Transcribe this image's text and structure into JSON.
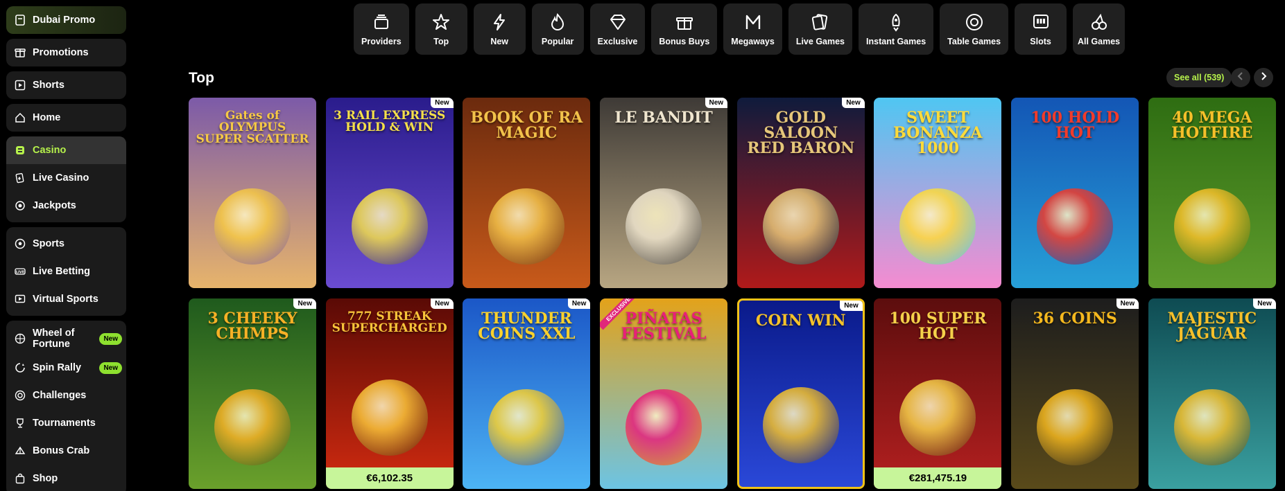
{
  "sidebar": {
    "promo": "Dubai Promo",
    "single": [
      {
        "label": "Promotions",
        "icon": "gift-box-icon"
      },
      {
        "label": "Shorts",
        "icon": "play-square-icon"
      },
      {
        "label": "Home",
        "icon": "home-icon"
      }
    ],
    "casino_group": [
      {
        "label": "Casino",
        "icon": "casino-icon",
        "active": true
      },
      {
        "label": "Live Casino",
        "icon": "live-casino-icon"
      },
      {
        "label": "Jackpots",
        "icon": "jackpot-icon"
      }
    ],
    "sports_group": [
      {
        "label": "Sports",
        "icon": "football-icon"
      },
      {
        "label": "Live Betting",
        "icon": "live-icon"
      },
      {
        "label": "Virtual Sports",
        "icon": "virtual-icon"
      }
    ],
    "extras_group": [
      {
        "label": "Wheel of Fortune",
        "icon": "wheel-icon",
        "badge": "New"
      },
      {
        "label": "Spin Rally",
        "icon": "spin-icon",
        "badge": "New"
      },
      {
        "label": "Challenges",
        "icon": "target-icon"
      },
      {
        "label": "Tournaments",
        "icon": "trophy-icon"
      },
      {
        "label": "Bonus Crab",
        "icon": "crab-icon"
      },
      {
        "label": "Shop",
        "icon": "bag-icon"
      }
    ]
  },
  "categories": [
    {
      "label": "Providers",
      "icon": "stack-icon"
    },
    {
      "label": "Top",
      "icon": "star-icon"
    },
    {
      "label": "New",
      "icon": "lightning-icon"
    },
    {
      "label": "Popular",
      "icon": "flame-icon"
    },
    {
      "label": "Exclusive",
      "icon": "diamond-icon"
    },
    {
      "label": "Bonus Buys",
      "icon": "gift-icon"
    },
    {
      "label": "Megaways",
      "icon": "megaways-icon"
    },
    {
      "label": "Live Games",
      "icon": "cards-icon"
    },
    {
      "label": "Instant Games",
      "icon": "rocket-icon"
    },
    {
      "label": "Table Games",
      "icon": "chip-icon"
    },
    {
      "label": "Slots",
      "icon": "slot-icon"
    },
    {
      "label": "All Games",
      "icon": "cherries-icon"
    }
  ],
  "section": {
    "title": "Top",
    "see_all": "See all (539)"
  },
  "games": [
    {
      "title": "Gates of Olympus Super Scatter",
      "art": "Gates of OLYMPUS SUPER SCATTER",
      "new": false,
      "bg": "#7c5aa8",
      "bg2": "#e7b46b",
      "fg": "#f6c945"
    },
    {
      "title": "3 Rail Express Hold & Win",
      "art": "3 RAIL EXPRESS HOLD & WIN",
      "new": true,
      "bg": "#2a1c8c",
      "bg2": "#6b4cd1",
      "fg": "#f5e04a"
    },
    {
      "title": "Book of Ra Magic",
      "art": "BOOK OF RA MAGIC",
      "new": false,
      "bg": "#6b2a0e",
      "bg2": "#c85a1a",
      "fg": "#f2c24a"
    },
    {
      "title": "Le Bandit",
      "art": "LE BANDIT",
      "new": true,
      "bg": "#3e3a36",
      "bg2": "#b8a682",
      "fg": "#f0e6cf"
    },
    {
      "title": "Gold Saloon Red Baron",
      "art": "GOLD SALOON RED BARON",
      "new": true,
      "bg": "#0f1b3c",
      "bg2": "#b01a1a",
      "fg": "#e6c77a"
    },
    {
      "title": "Sweet Bonanza 1000",
      "art": "SWEET BONANZA 1000",
      "new": false,
      "bg": "#4fc6f2",
      "bg2": "#f58bd0",
      "fg": "#ffdb3a"
    },
    {
      "title": "100 Hold Hot",
      "art": "100 HOLD HOT",
      "new": false,
      "bg": "#1356b5",
      "bg2": "#27a0d8",
      "fg": "#f23b2b"
    },
    {
      "title": "40 Mega Hotfire",
      "art": "40 MEGA HOTFIRE",
      "new": false,
      "bg": "#2e6d12",
      "bg2": "#5e9b2c",
      "fg": "#f6c02a"
    },
    {
      "title": "3 Cheeky Chimps",
      "art": "3 CHEEKY CHIMPS",
      "new": true,
      "bg": "#1f5a1d",
      "bg2": "#6aa02b",
      "fg": "#f6b126"
    },
    {
      "title": "777 Streak Supercharged",
      "art": "777 STREAK SUPERCHARGED",
      "new": true,
      "bg": "#5a0a05",
      "bg2": "#d22b10",
      "fg": "#f8c43a",
      "jackpot": "€6,102.35"
    },
    {
      "title": "Thunder Coins XXL",
      "art": "THUNDER COINS XXL",
      "new": true,
      "bg": "#1b57c7",
      "bg2": "#4db4f5",
      "fg": "#f9d12e"
    },
    {
      "title": "Piñatas Festival",
      "art": "PIÑATAS FESTIVAL",
      "new": false,
      "exclusive": "EXCLUSIVE",
      "bg": "#e3a21a",
      "bg2": "#6cc4e4",
      "fg": "#e81f7a"
    },
    {
      "title": "Coin Win",
      "art": "COIN WIN",
      "new": true,
      "bg": "#0a1a8a",
      "bg2": "#2a48d8",
      "fg": "#f5c22a",
      "border": true
    },
    {
      "title": "100 Super Hot",
      "art": "100 SUPER HOT",
      "new": false,
      "bg": "#5c0d0d",
      "bg2": "#b52020",
      "fg": "#f5d04a",
      "jackpot": "€281,475.19"
    },
    {
      "title": "36 Coins",
      "art": "36 COINS",
      "new": true,
      "bg": "#1d1d1d",
      "bg2": "#5a4a1a",
      "fg": "#f5b81e"
    },
    {
      "title": "Majestic Jaguar",
      "art": "MAJESTIC JAGUAR",
      "new": true,
      "bg": "#0e4b52",
      "bg2": "#3aa0a0",
      "fg": "#f6c02a"
    }
  ],
  "labels": {
    "new": "New"
  }
}
